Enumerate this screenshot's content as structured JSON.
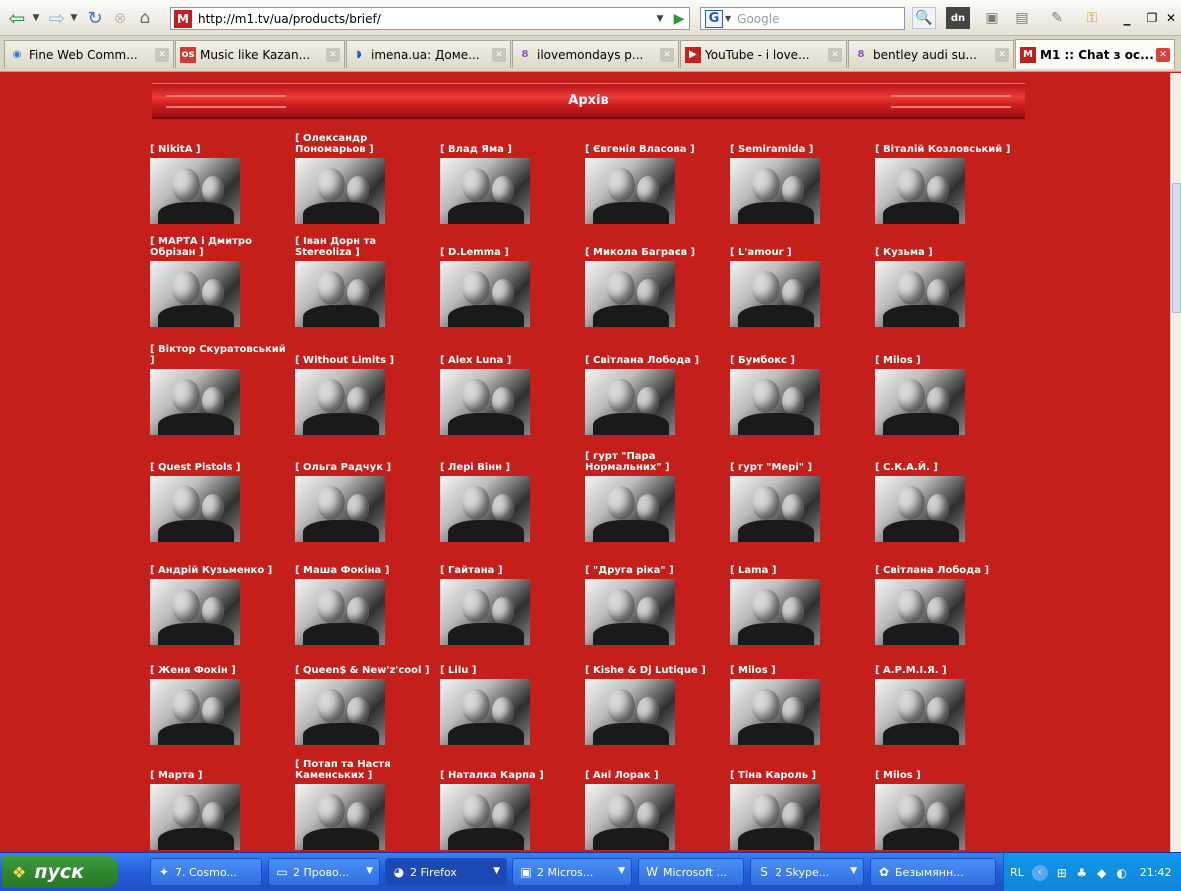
{
  "browser": {
    "url": "http://m1.tv/ua/products/brief/",
    "search_placeholder": "Google",
    "search_engine_letter": "G",
    "favicon_letter": "M",
    "dn_label": "dn"
  },
  "tabs": [
    {
      "title": "Fine Web Comm...",
      "icon": "web-icon",
      "active": false
    },
    {
      "title": "Music like Kazan...",
      "icon": "music-icon",
      "active": false
    },
    {
      "title": "imena.ua: Доме...",
      "icon": "imena-icon",
      "active": false
    },
    {
      "title": "ilovemondays p...",
      "icon": "ilove-icon",
      "active": false
    },
    {
      "title": "YouTube - i love...",
      "icon": "youtube-icon",
      "active": false
    },
    {
      "title": "bentley audi su...",
      "icon": "ilove-icon",
      "active": false
    },
    {
      "title": "M1 :: Chat з ос...",
      "icon": "m1-icon",
      "active": true
    }
  ],
  "page": {
    "archive_title": "Архів",
    "artists": [
      "[ NikitA ]",
      "[ Олександр Пономарьов ]",
      "[ Влад Яма ]",
      "[ Євгенія Власова ]",
      "[ Semiramida ]",
      "[ Віталій Козловський ]",
      "[ МАРТА і Дмитро Обрізан ]",
      "[ Іван Дорн та Stereoliza ]",
      "[ D.Lemma ]",
      "[ Микола Багрaєв ]",
      "[ L'amour ]",
      "[ Кузьма ]",
      "[ Віктор Скуратовський ]",
      "[ Without Limits ]",
      "[ Alex Luna ]",
      "[ Світлана Лобода ]",
      "[ Бумбокс ]",
      "[ Milos ]",
      "[ Quest Pistols ]",
      "[ Ольга Радчук ]",
      "[ Лері Вінн ]",
      "[ гурт \"Пара Нормальних\" ]",
      "[ гурт \"Мері\" ]",
      "[ С.К.А.Й. ]",
      "[ Андрій Кузьменко ]",
      "[ Маша Фокіна ]",
      "[ Гайтана ]",
      "[ \"Друга ріка\" ]",
      "[ Lama ]",
      "[ Світлана Лобода ]",
      "[ Женя Фокін ]",
      "[ Queen$ & New'z'cool ]",
      "[ Lilu ]",
      "[ Kishe & Dj Lutique ]",
      "[ Milos ]",
      "[ А.Р.М.І.Я. ]",
      "[ Марта ]",
      "[ Потап та Настя Каменських ]",
      "[ Наталка Карпа ]",
      "[ Ані Лорак ]",
      "[ Тіна Кароль ]",
      "[ Milos ]"
    ]
  },
  "taskbar": {
    "start_label": "пуск",
    "items": [
      {
        "label": "7. Cosmo...",
        "icon": "cosmo-icon",
        "active": false,
        "dropdown": false
      },
      {
        "label": "2 Прово...",
        "icon": "folder-icon",
        "active": false,
        "dropdown": true
      },
      {
        "label": "2 Firefox",
        "icon": "firefox-icon",
        "active": true,
        "dropdown": true
      },
      {
        "label": "2 Micros...",
        "icon": "powerpoint-icon",
        "active": false,
        "dropdown": true
      },
      {
        "label": "Microsoft ...",
        "icon": "word-icon",
        "active": false,
        "dropdown": false
      },
      {
        "label": "2 Skype...",
        "icon": "skype-icon",
        "active": false,
        "dropdown": true
      },
      {
        "label": "Безымянн...",
        "icon": "paint-icon",
        "active": false,
        "dropdown": false
      }
    ],
    "tray": {
      "lang": "RL",
      "clock": "21:42"
    }
  },
  "colors": {
    "page_bg": "#c41f1a",
    "archive_bar": "#e32b27",
    "taskbar": "#245edb",
    "start": "#2f8a2f"
  }
}
